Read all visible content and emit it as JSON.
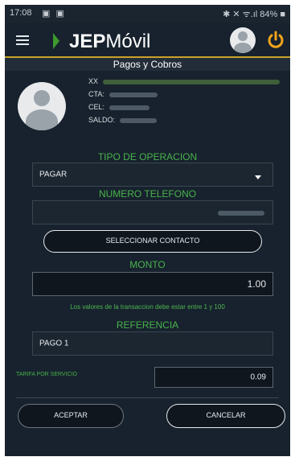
{
  "status_bar": {
    "time": "17:08",
    "left_icons": "▣ ▣",
    "right_text": "✱ ✕ ᯤ.ıl 84% ■"
  },
  "app_bar": {
    "logo_bold": "JEP",
    "logo_regular": "Móvil",
    "icons": [
      "menu-icon",
      "avatar-icon",
      "power-icon"
    ]
  },
  "screen_title": "Pagos y Cobros",
  "account": {
    "name_prefix": "XX",
    "cta_label": "CTA:",
    "cel_label": "CEL:",
    "saldo_label": "SALDO:"
  },
  "form": {
    "tipo_operacion_label": "TIPO DE OPERACION",
    "tipo_operacion_value": "PAGAR",
    "numero_telefono_label": "NUMERO TELEFONO",
    "seleccionar_contacto": "SELECCIONAR CONTACTO",
    "monto_label": "MONTO",
    "monto_value": "1.00",
    "hint": "Los valores de la transaccion debe estar entre 1 y 100",
    "referencia_label": "REFERENCIA",
    "referencia_value": "PAGO 1",
    "tarifa_label": "TARIFA POR SERVICIO",
    "tarifa_value": "0.09"
  },
  "buttons": {
    "aceptar": "ACEPTAR",
    "cancelar": "CANCELAR"
  },
  "colors": {
    "background": "#17222e",
    "accent_green": "#49b24a",
    "power_orange": "#f2a31b",
    "title_border": "#c9a227"
  }
}
